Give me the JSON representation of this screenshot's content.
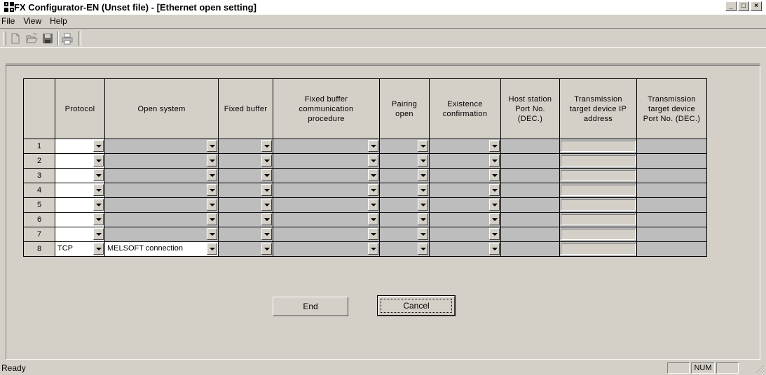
{
  "window": {
    "title": "FX Configurator-EN (Unset file) - [Ethernet open setting]",
    "controls": {
      "minimize": "_",
      "maximize": "□",
      "close": "×"
    }
  },
  "menu": [
    "File",
    "View",
    "Help"
  ],
  "toolbar": {
    "icons": [
      "new-file-icon",
      "open-folder-icon",
      "save-disk-icon",
      "print-icon"
    ]
  },
  "table": {
    "headers": [
      "Protocol",
      "Open system",
      "Fixed buffer",
      "Fixed buffer communication procedure",
      "Pairing open",
      "Existence confirmation",
      "Host station Port No. (DEC.)",
      "Transmission target device IP address",
      "Transmission target device Port No. (DEC.)"
    ],
    "rows": [
      {
        "no": "1",
        "protocol": "",
        "open_system": ""
      },
      {
        "no": "2",
        "protocol": "",
        "open_system": ""
      },
      {
        "no": "3",
        "protocol": "",
        "open_system": ""
      },
      {
        "no": "4",
        "protocol": "",
        "open_system": ""
      },
      {
        "no": "5",
        "protocol": "",
        "open_system": ""
      },
      {
        "no": "6",
        "protocol": "",
        "open_system": ""
      },
      {
        "no": "7",
        "protocol": "",
        "open_system": ""
      },
      {
        "no": "8",
        "protocol": "TCP",
        "open_system": "MELSOFT connection"
      }
    ]
  },
  "buttons": {
    "end": "End",
    "cancel": "Cancel"
  },
  "status": {
    "text": "Ready",
    "num": "NUM"
  },
  "colors": {
    "face": "#d4d0c8",
    "disabled_cell": "#bdbdbd"
  }
}
